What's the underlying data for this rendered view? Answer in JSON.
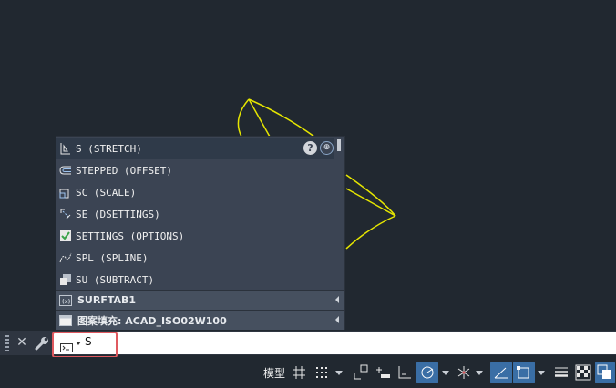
{
  "autocomplete": {
    "items": [
      {
        "label": "S (STRETCH)",
        "icon": "stretch-icon",
        "selected": true
      },
      {
        "label": "STEPPED (OFFSET)",
        "icon": "offset-icon"
      },
      {
        "label": "SC (SCALE)",
        "icon": "scale-icon"
      },
      {
        "label": "SE (DSETTINGS)",
        "icon": "dsettings-icon"
      },
      {
        "label": "SETTINGS (OPTIONS)",
        "icon": "options-checkbox-icon"
      },
      {
        "label": "SPL (SPLINE)",
        "icon": "spline-icon"
      },
      {
        "label": "SU (SUBTRACT)",
        "icon": "subtract-icon"
      }
    ],
    "sections": [
      {
        "label": "SURFTAB1",
        "icon": "system-variable-icon"
      },
      {
        "label": "图案填充: ACAD_ISO02W100",
        "icon": "hatch-pattern-icon"
      }
    ],
    "help_label": "?"
  },
  "command_line": {
    "value": "S"
  },
  "status_bar": {
    "model_label": "模型"
  },
  "colors": {
    "canvas": "#212830",
    "geometry": "#e6e600",
    "highlight": "#e05a60"
  }
}
